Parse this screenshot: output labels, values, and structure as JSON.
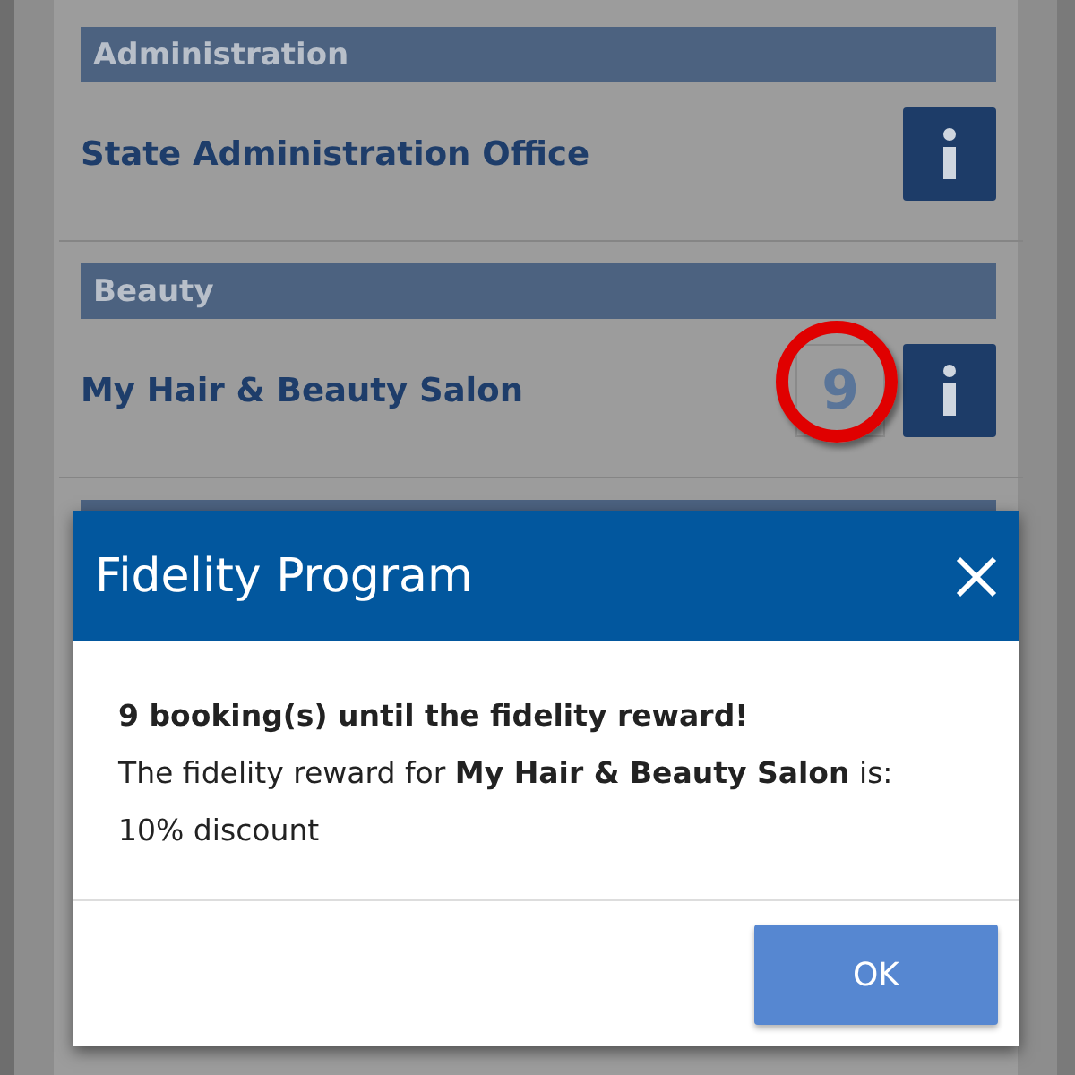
{
  "sections": [
    {
      "header": "Administration",
      "items": [
        {
          "name": "State Administration Office"
        }
      ]
    },
    {
      "header": "Beauty",
      "items": [
        {
          "name": "My Hair & Beauty Salon",
          "badge": "9",
          "highlighted": true
        }
      ]
    },
    {
      "kind": "covered"
    }
  ],
  "dialog": {
    "title": "Fidelity Program",
    "heading": "9 booking(s) until the fidelity reward!",
    "message": "The fidelity reward for **My Hair & Beauty Salon** is:",
    "reward": "10% discount",
    "button": "OK"
  }
}
